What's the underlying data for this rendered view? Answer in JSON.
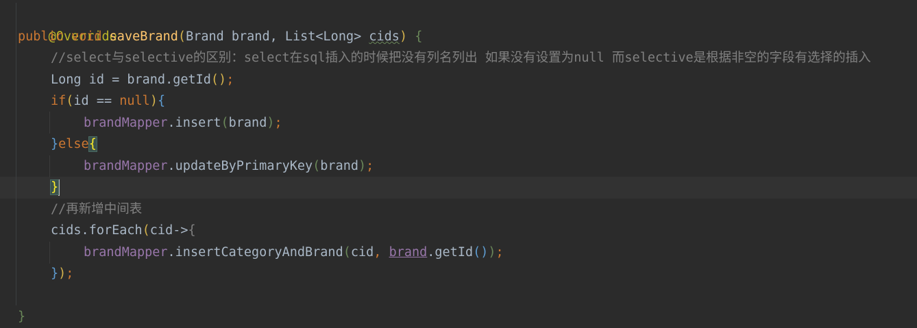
{
  "lines": [
    {
      "annotation": "@Override"
    },
    {
      "kw_public": "public",
      "kw_void": "void",
      "method": "saveBrand",
      "open": "(",
      "t1": "Brand brand, List<Long> ",
      "param2": "cids",
      "close": ")",
      "brace": "{"
    },
    {
      "comment": "//select与selective的区别：select在sql插入的时候把没有列名列出 如果没有设置为null 而selective是根据非空的字段有选择的插入"
    },
    {
      "text": "Long id = brand.getId",
      "p": "()",
      "semi": ";"
    },
    {
      "kw_if": "if",
      "open": "(",
      "mid": "id == ",
      "kw_null": "null",
      "close": ")",
      "brace": "{"
    },
    {
      "field": "brandMapper",
      "call": ".insert",
      "open": "(",
      "arg": "brand",
      "close": ")",
      "semi": ";"
    },
    {
      "rbrace": "}",
      "kw_else": "else",
      "lbrace": "{"
    },
    {
      "field": "brandMapper",
      "call": ".updateByPrimaryKey",
      "open": "(",
      "arg": "brand",
      "close": ")",
      "semi": ";"
    },
    {
      "rbrace": "}"
    },
    {
      "comment": "//再新增中间表"
    },
    {
      "text": "cids.forEach",
      "open": "(",
      "mid": "cid->",
      "brace": "{"
    },
    {
      "field": "brandMapper",
      "call": ".insertCategoryAndBrand",
      "open": "(",
      "arg1": "cid",
      "comma": ", ",
      "arg2": "brand",
      "call2": ".getId",
      "p2": "()",
      "close": ")",
      "semi": ";"
    },
    {
      "rbrace": "}",
      "close": ")",
      "semi": ";"
    },
    {
      "empty": ""
    },
    {
      "rbrace": "}"
    }
  ]
}
